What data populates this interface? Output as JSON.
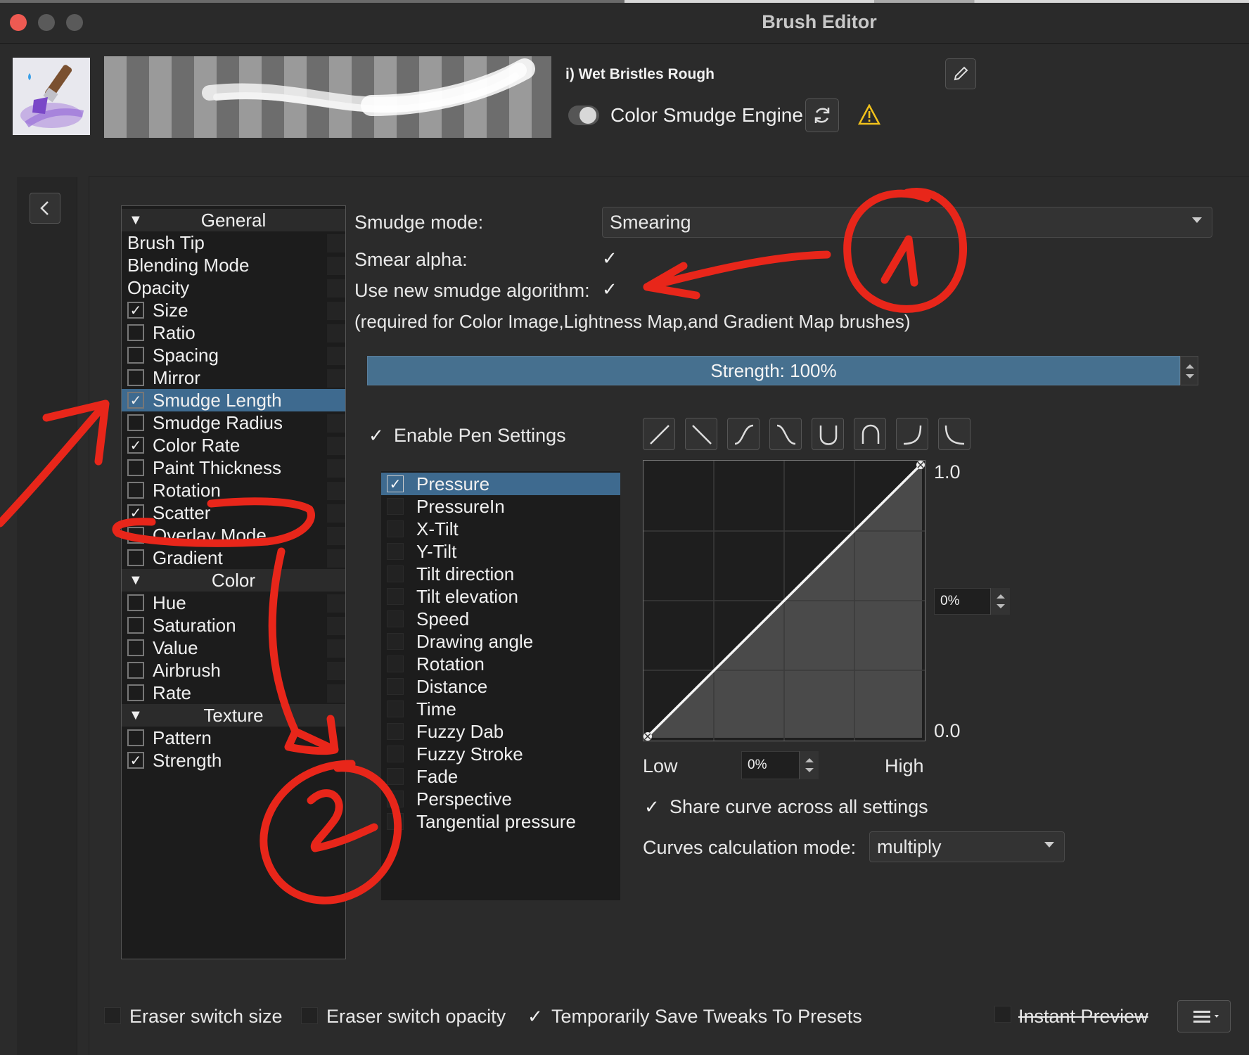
{
  "window": {
    "title": "Brush Editor"
  },
  "header": {
    "preset_name": "i) Wet Bristles Rough",
    "engine_label": "Color Smudge Engine"
  },
  "options": {
    "sections": [
      {
        "title": "General",
        "items": [
          {
            "label": "Brush Tip",
            "checkbox": false,
            "checked": false
          },
          {
            "label": "Blending Mode",
            "checkbox": false,
            "checked": false
          },
          {
            "label": "Opacity",
            "checkbox": false,
            "checked": false
          },
          {
            "label": "Size",
            "checkbox": true,
            "checked": true
          },
          {
            "label": "Ratio",
            "checkbox": true,
            "checked": false
          },
          {
            "label": "Spacing",
            "checkbox": true,
            "checked": false
          },
          {
            "label": "Mirror",
            "checkbox": true,
            "checked": false
          },
          {
            "label": "Smudge Length",
            "checkbox": true,
            "checked": true,
            "selected": true
          },
          {
            "label": "Smudge Radius",
            "checkbox": true,
            "checked": false
          },
          {
            "label": "Color Rate",
            "checkbox": true,
            "checked": true
          },
          {
            "label": "Paint Thickness",
            "checkbox": true,
            "checked": false
          },
          {
            "label": "Rotation",
            "checkbox": true,
            "checked": false
          },
          {
            "label": "Scatter",
            "checkbox": true,
            "checked": true
          },
          {
            "label": "Overlay Mode",
            "checkbox": true,
            "checked": false
          },
          {
            "label": "Gradient",
            "checkbox": true,
            "checked": false
          }
        ]
      },
      {
        "title": "Color",
        "items": [
          {
            "label": "Hue",
            "checkbox": true,
            "checked": false
          },
          {
            "label": "Saturation",
            "checkbox": true,
            "checked": false
          },
          {
            "label": "Value",
            "checkbox": true,
            "checked": false
          },
          {
            "label": "Airbrush",
            "checkbox": true,
            "checked": false
          },
          {
            "label": "Rate",
            "checkbox": true,
            "checked": false
          }
        ]
      },
      {
        "title": "Texture",
        "items": [
          {
            "label": "Pattern",
            "checkbox": true,
            "checked": false
          },
          {
            "label": "Strength",
            "checkbox": true,
            "checked": true
          }
        ]
      }
    ]
  },
  "settings": {
    "smudge_mode_label": "Smudge mode:",
    "smudge_mode_value": "Smearing",
    "smear_alpha_label": "Smear alpha:",
    "smear_alpha_checked": true,
    "new_algorithm_label": "Use new smudge algorithm:",
    "new_algorithm_checked": true,
    "note": "(required for Color Image,Lightness Map,and Gradient Map brushes)",
    "strength_label": "Strength: 100%",
    "strength_value": 1.0,
    "enable_pen_label": "Enable Pen Settings",
    "enable_pen_checked": true
  },
  "sensors": [
    {
      "label": "Pressure",
      "checked": true,
      "selected": true
    },
    {
      "label": "PressureIn",
      "checked": false
    },
    {
      "label": "X-Tilt",
      "checked": false
    },
    {
      "label": "Y-Tilt",
      "checked": false
    },
    {
      "label": "Tilt direction",
      "checked": false
    },
    {
      "label": "Tilt elevation",
      "checked": false
    },
    {
      "label": "Speed",
      "checked": false
    },
    {
      "label": "Drawing angle",
      "checked": false
    },
    {
      "label": "Rotation",
      "checked": false
    },
    {
      "label": "Distance",
      "checked": false
    },
    {
      "label": "Time",
      "checked": false
    },
    {
      "label": "Fuzzy Dab",
      "checked": false
    },
    {
      "label": "Fuzzy Stroke",
      "checked": false
    },
    {
      "label": "Fade",
      "checked": false
    },
    {
      "label": "Perspective",
      "checked": false
    },
    {
      "label": "Tangential pressure",
      "checked": false
    }
  ],
  "curve": {
    "presets": [
      "linear-icon",
      "reverse-linear-icon",
      "s-curve-icon",
      "reverse-s-curve-icon",
      "u-curve-icon",
      "arch-curve-icon",
      "j-curve-icon",
      "l-curve-icon"
    ],
    "y_max_label": "1.0",
    "y_min_label": "0.0",
    "y_value": "0%",
    "x_min_label": "Low",
    "x_max_label": "High",
    "x_value": "0%",
    "share_label": "Share curve across all settings",
    "share_checked": true,
    "calc_mode_label": "Curves calculation mode:",
    "calc_mode_value": "multiply"
  },
  "footer": {
    "eraser_size_label": "Eraser switch size",
    "eraser_size_checked": false,
    "eraser_opacity_label": "Eraser switch opacity",
    "eraser_opacity_checked": false,
    "temp_save_label": "Temporarily Save Tweaks To Presets",
    "temp_save_checked": true,
    "instant_preview_label": "Instant Preview",
    "instant_preview_checked": false
  },
  "colors": {
    "selection": "#3e6a8f",
    "annotation_red": "#e8261a",
    "warning_yellow": "#f2c21b"
  }
}
